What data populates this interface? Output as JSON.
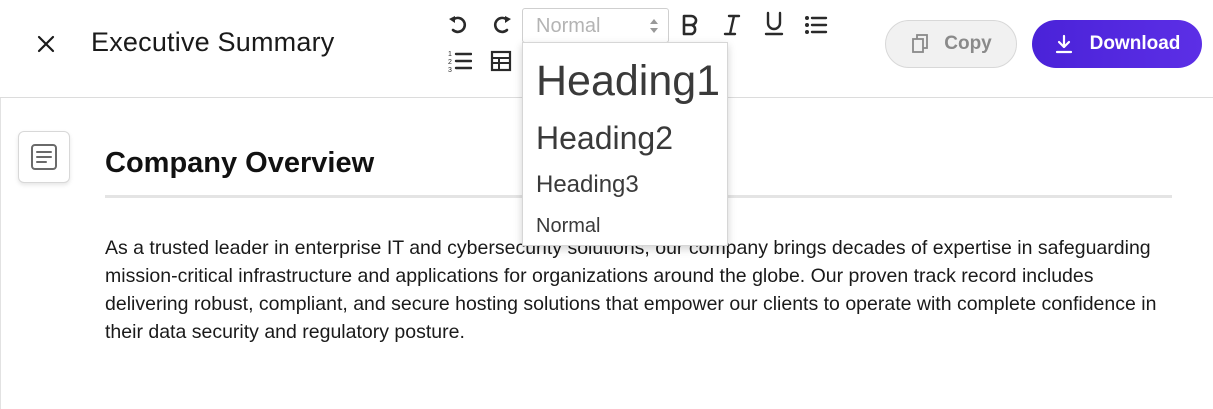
{
  "header": {
    "title": "Executive Summary",
    "copy_label": "Copy",
    "download_label": "Download"
  },
  "toolbar": {
    "style_select_value": "Normal",
    "icons": [
      "undo-icon",
      "redo-icon",
      "bold-icon",
      "italic-icon",
      "underline-icon",
      "bullet-list-icon",
      "numbered-list-icon",
      "table-icon"
    ]
  },
  "style_dropdown": {
    "options": [
      "Heading1",
      "Heading2",
      "Heading3",
      "Normal"
    ]
  },
  "content": {
    "section_heading": "Company Overview",
    "body": "As a trusted leader in enterprise IT and cybersecurity solutions, our company brings decades of expertise in safeguarding mission-critical infrastructure and applications for organizations around the globe. Our proven track record includes delivering robust, compliant, and secure hosting solutions that empower our clients to operate with complete confidence in their data security and regulatory posture."
  },
  "colors": {
    "accent": "#5028e0",
    "copy_bg": "#f1f1f1",
    "copy_text": "#8a8a8a"
  }
}
